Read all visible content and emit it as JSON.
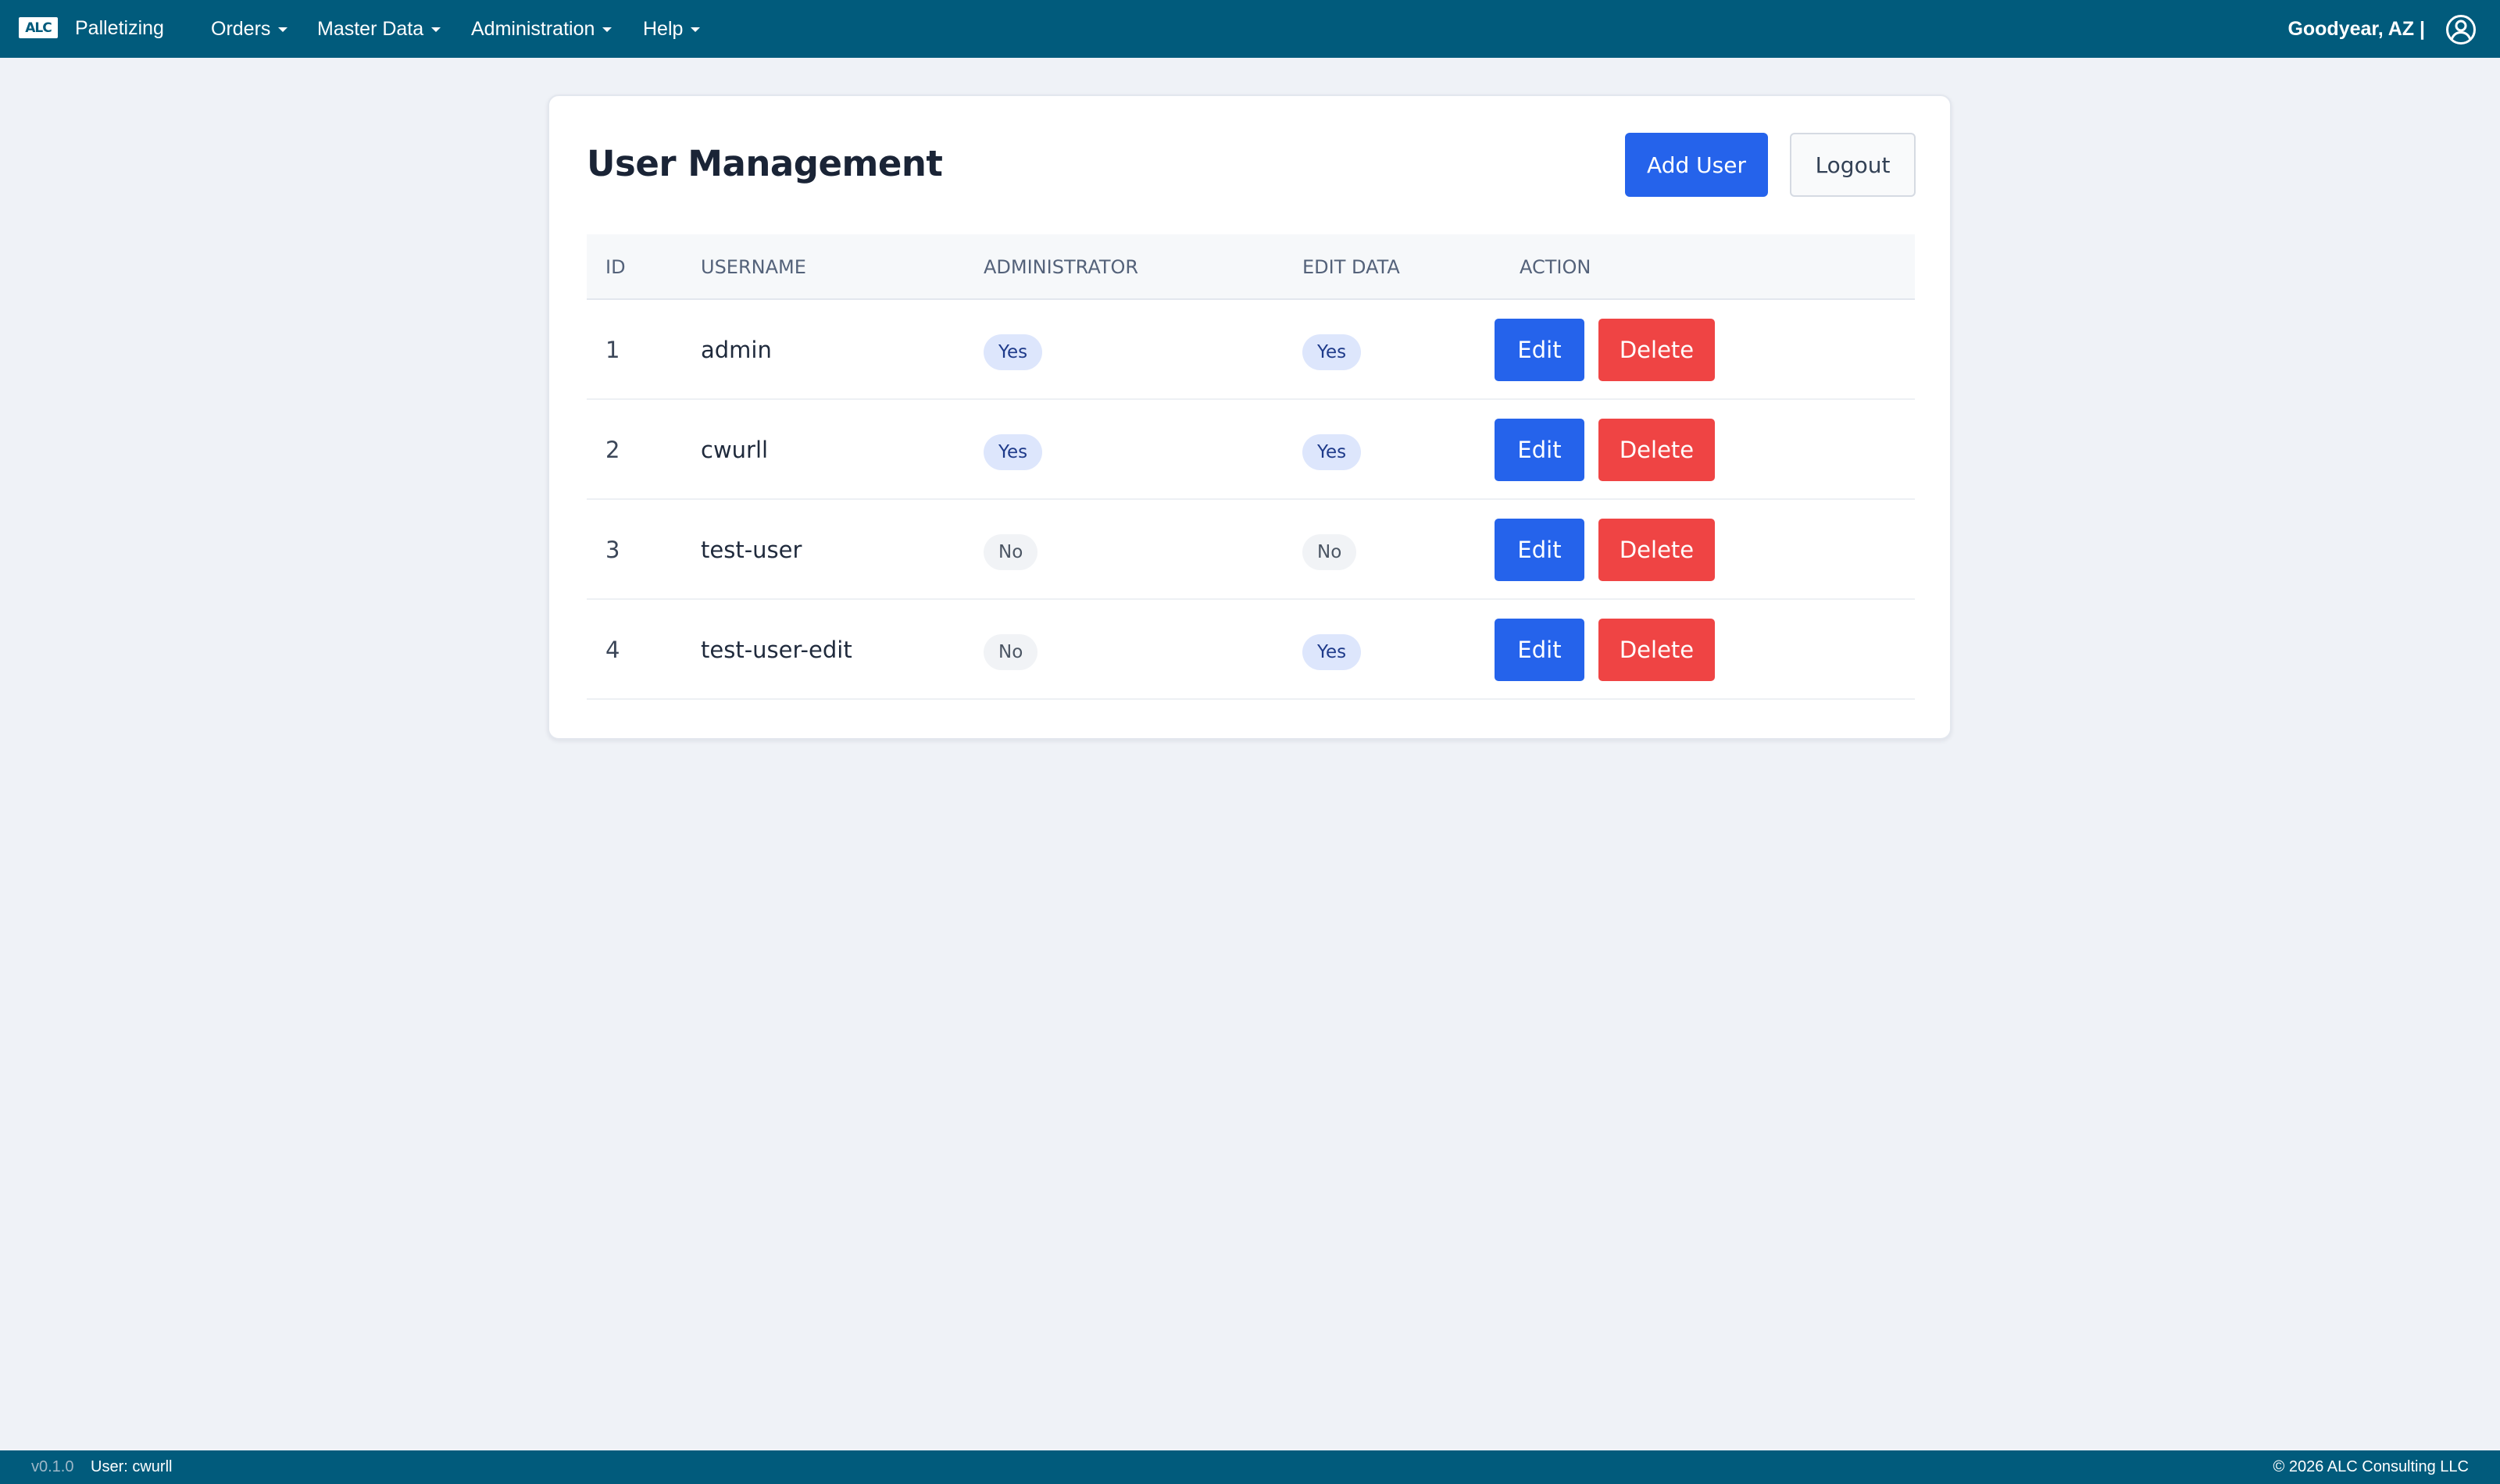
{
  "app": {
    "logo_text": "ALC",
    "brand": "Palletizing"
  },
  "nav": {
    "items": [
      {
        "label": "Orders"
      },
      {
        "label": "Master Data"
      },
      {
        "label": "Administration"
      },
      {
        "label": "Help"
      }
    ],
    "location": "Goodyear, AZ |",
    "user_icon": "user-circle-icon"
  },
  "page": {
    "title": "User Management",
    "add_user_label": "Add User",
    "logout_label": "Logout"
  },
  "table": {
    "headers": [
      "ID",
      "USERNAME",
      "ADMINISTRATOR",
      "EDIT DATA",
      "ACTION"
    ],
    "edit_label": "Edit",
    "delete_label": "Delete",
    "rows": [
      {
        "id": "1",
        "username": "admin",
        "administrator": "Yes",
        "edit_data": "Yes"
      },
      {
        "id": "2",
        "username": "cwurll",
        "administrator": "Yes",
        "edit_data": "Yes"
      },
      {
        "id": "3",
        "username": "test-user",
        "administrator": "No",
        "edit_data": "No"
      },
      {
        "id": "4",
        "username": "test-user-edit",
        "administrator": "No",
        "edit_data": "Yes"
      }
    ]
  },
  "footer": {
    "version": "v0.1.0",
    "user": "User: cwurll",
    "copyright": "© 2026 ALC Consulting LLC"
  },
  "colors": {
    "nav_bg": "#015b7c",
    "primary": "#2563eb",
    "danger": "#ef4444",
    "page_bg": "#eff2f7"
  }
}
